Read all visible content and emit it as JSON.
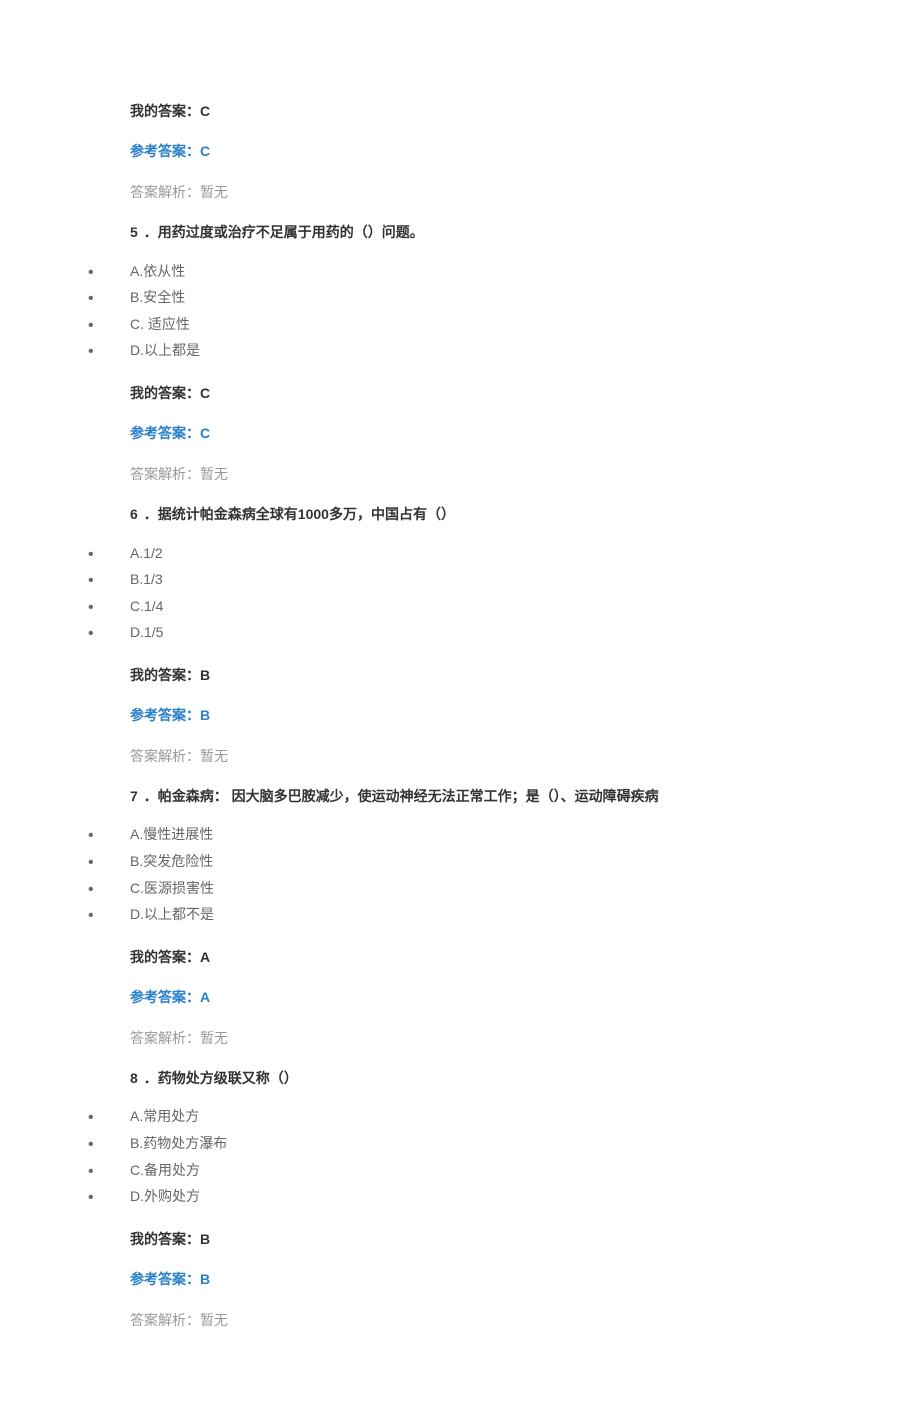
{
  "labels": {
    "my_answer_prefix": "我的答案：",
    "ref_answer_prefix": "参考答案：",
    "analysis_prefix": "答案解析：",
    "analysis_none": "暂无"
  },
  "questions": [
    {
      "number": "",
      "text": "",
      "options": [],
      "my_answer": "C",
      "ref_answer": "C",
      "analysis": "暂无"
    },
    {
      "number": "5",
      "text": "．用药过度或治疗不足属于用药的（）问题。",
      "options": [
        "A.依从性",
        "B.安全性",
        "C. 适应性",
        "D.以上都是"
      ],
      "my_answer": "C",
      "ref_answer": "C",
      "analysis": "暂无"
    },
    {
      "number": "6",
      "text": "．据统计帕金森病全球有1000多万，中国占有（）",
      "options": [
        "A.1/2",
        "B.1/3",
        "C.1/4",
        "D.1/5"
      ],
      "my_answer": "B",
      "ref_answer": "B",
      "analysis": "暂无"
    },
    {
      "number": "7",
      "text": "．帕金森病：    因大脑多巴胺减少，使运动神经无法正常工作；是（）、运动障碍疾病",
      "options": [
        "A.慢性进展性",
        "B.突发危险性",
        "C.医源损害性",
        "D.以上都不是"
      ],
      "my_answer": "A",
      "ref_answer": "A",
      "analysis": "暂无"
    },
    {
      "number": "8",
      "text": "．药物处方级联又称（）",
      "options": [
        "A.常用处方",
        "B.药物处方瀑布",
        "C.备用处方",
        "D.外购处方"
      ],
      "my_answer": "B",
      "ref_answer": "B",
      "analysis": "暂无"
    }
  ]
}
